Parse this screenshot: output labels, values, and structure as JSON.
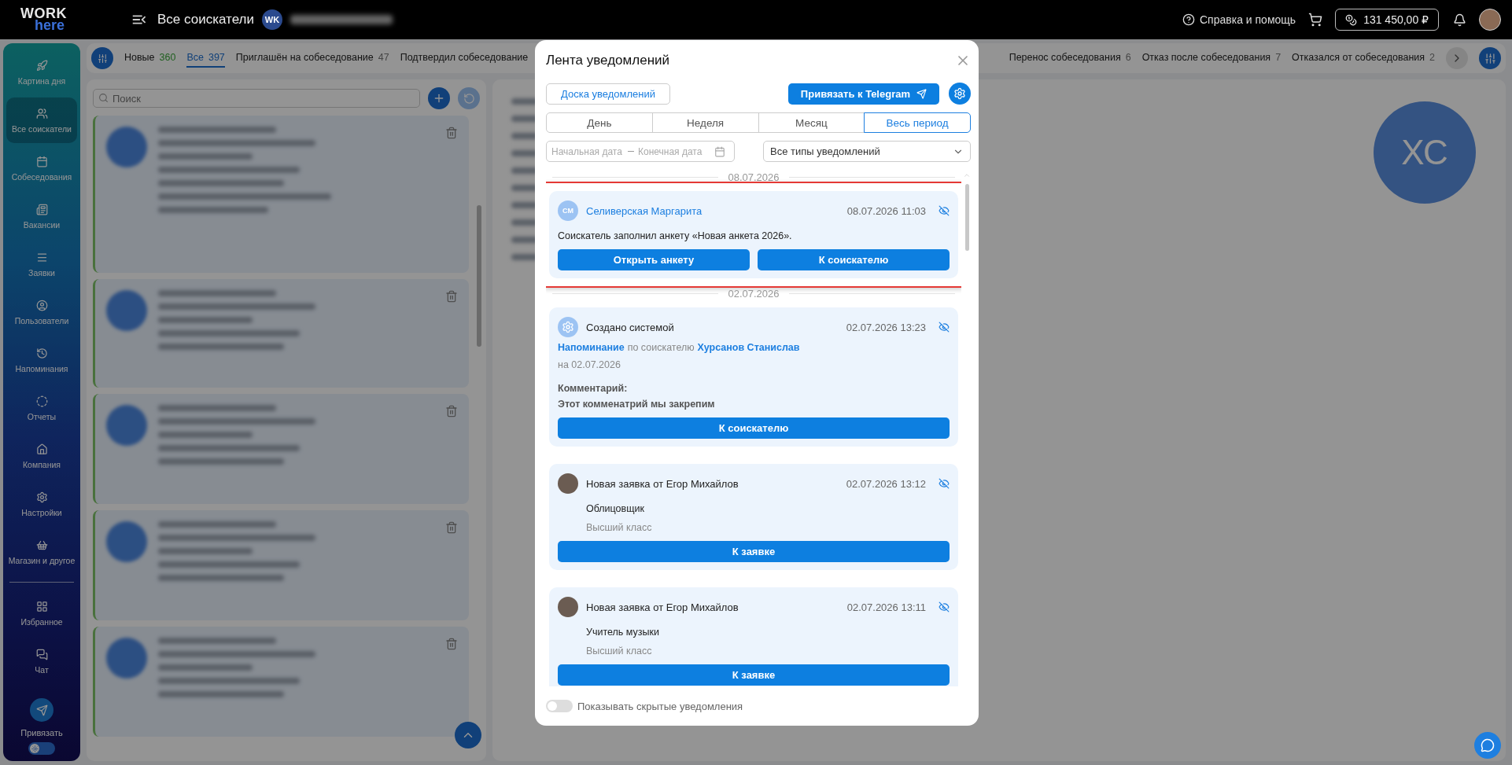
{
  "header": {
    "logo": {
      "top": "WORK",
      "bottom": "here"
    },
    "title": "Все соискатели",
    "company_initials": "WK",
    "help": "Справка и помощь",
    "balance": "131 450,00 ₽"
  },
  "sidebar": {
    "items": [
      {
        "label": "Картина дня",
        "selected": false
      },
      {
        "label": "Все соискатели",
        "selected": true
      },
      {
        "label": "Собеседования",
        "selected": false
      },
      {
        "label": "Вакансии",
        "selected": false
      },
      {
        "label": "Заявки",
        "selected": false
      },
      {
        "label": "Пользователи",
        "selected": false
      },
      {
        "label": "Напоминания",
        "selected": false
      },
      {
        "label": "Отчеты",
        "selected": false
      },
      {
        "label": "Компания",
        "selected": false
      },
      {
        "label": "Настройки",
        "selected": false
      },
      {
        "label": "Магазин и другое",
        "selected": false
      }
    ],
    "bottom_items": [
      {
        "label": "Избранное",
        "selected": false
      },
      {
        "label": "Чат",
        "selected": false
      }
    ],
    "telegram_label": "Привязать",
    "theme_toggle": {
      "on": false
    }
  },
  "status_tabs": {
    "left": [
      {
        "label": "Новые",
        "count": "360",
        "kind": "new",
        "selected": false
      },
      {
        "label": "Все",
        "count": "397",
        "kind": "status",
        "selected": true
      },
      {
        "label": "Приглашён на собеседование",
        "count": "47",
        "kind": "status",
        "selected": false
      },
      {
        "label": "Подтвердил собеседование",
        "selected": false
      }
    ],
    "right": [
      {
        "label": "Перенос собеседования",
        "count": "6",
        "kind": "status",
        "selected": false
      },
      {
        "label": "Отказ после собеседования",
        "count": "7",
        "kind": "status",
        "selected": false
      },
      {
        "label": "Отказался от собеседования",
        "count": "2",
        "kind": "status",
        "selected": false
      }
    ]
  },
  "candidates": {
    "search": {
      "placeholder": "Поиск"
    }
  },
  "profile": {
    "initials": "ХС"
  },
  "notifications_modal": {
    "title": "Лента уведомлений",
    "board_button": "Доска уведомлений",
    "telegram_button": "Привязать к Telegram",
    "periods": [
      {
        "label": "День",
        "selected": false
      },
      {
        "label": "Неделя",
        "selected": false
      },
      {
        "label": "Месяц",
        "selected": false
      },
      {
        "label": "Весь период",
        "selected": true
      }
    ],
    "date_from": {
      "placeholder": "Начальная дата"
    },
    "date_to": {
      "placeholder": "Конечная дата"
    },
    "type_select": {
      "value": "Все типы уведомлений"
    },
    "feed": [
      {
        "kind": "date",
        "date": "08.07.2026"
      },
      {
        "kind": "candidate",
        "highlighted": true,
        "initials": "СМ",
        "name": "Селиверская Маргарита",
        "time": "08.07.2026 11:03",
        "text": "Соискатель заполнил анкету «Новая анкета 2026».",
        "buttons": [
          "Открыть анкету",
          "К соискателю"
        ]
      },
      {
        "kind": "date",
        "date": "02.07.2026"
      },
      {
        "kind": "system",
        "highlighted": false,
        "name": "Создано системой",
        "time": "02.07.2026 13:23",
        "reminder_link": "Напоминание",
        "reminder_middle": "по соискателю",
        "candidate_link": "Хурсанов Станислав",
        "date_line": "на 02.07.2026",
        "comment_label": "Комментарий:",
        "comment": "Этот комменатрий мы закрепим",
        "buttons": [
          "К соискателю"
        ]
      },
      {
        "kind": "request",
        "highlighted": false,
        "name": "Новая заявка от Егор Михайлов",
        "time": "02.07.2026 13:12",
        "position": "Облицовщик",
        "grade": "Высший класс",
        "buttons": [
          "К заявке"
        ]
      },
      {
        "kind": "request",
        "highlighted": false,
        "name": "Новая заявка от Егор Михайлов",
        "time": "02.07.2026 13:11",
        "position": "Учитель музыки",
        "grade": "Высший класс",
        "buttons": [
          "К заявке"
        ]
      },
      {
        "kind": "partial"
      }
    ],
    "show_hidden": {
      "label": "Показывать скрытые уведомления",
      "on": false
    }
  }
}
